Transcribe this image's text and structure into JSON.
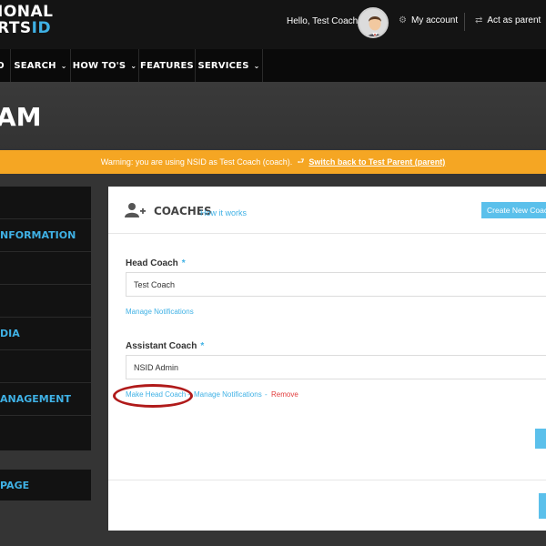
{
  "header": {
    "logo_line1": "IONAL",
    "logo_line2_plain": "RTS",
    "logo_line2_accent": "ID",
    "greeting": "Hello, Test Coach",
    "my_account": "My account",
    "act_as_parent": "Act as parent",
    "icons": [
      "gear-icon",
      "swap-arrows-icon"
    ]
  },
  "nav": {
    "items": [
      {
        "label": "O"
      },
      {
        "label": "SEARCH"
      },
      {
        "label": "HOW TO'S"
      },
      {
        "label": "FEATURES"
      },
      {
        "label": "SERVICES"
      }
    ]
  },
  "hero": {
    "title": "AM"
  },
  "warning": {
    "text": "Warning: you are using NSID as Test Coach (coach).",
    "switch_link": "Switch back to Test Parent (parent)"
  },
  "sidebar": {
    "items": [
      {
        "label": ""
      },
      {
        "label": "NFORMATION"
      },
      {
        "label": ""
      },
      {
        "label": ""
      },
      {
        "label": "DIA"
      },
      {
        "label": ""
      },
      {
        "label": "ANAGEMENT"
      },
      {
        "label": ""
      }
    ],
    "bottom_item": " PAGE"
  },
  "panel": {
    "title": "COACHES",
    "how_it_works": "How it works",
    "create_button": "Create New Coach",
    "head_coach": {
      "label": "Head Coach",
      "required": "*",
      "value": "Test Coach",
      "manage_link": "Manage Notifications"
    },
    "assistant_coach": {
      "label": "Assistant Coach",
      "required": "*",
      "value": "NSID Admin",
      "make_head_link": "Make Head Coach",
      "manage_link": "Manage Notifications",
      "separator": "-",
      "remove_link": "Remove"
    }
  },
  "colors": {
    "accent_blue": "#3fb1e5",
    "warning_orange": "#f5a623",
    "highlight_ring": "#b01a1a",
    "remove_red": "#e23c3c"
  }
}
